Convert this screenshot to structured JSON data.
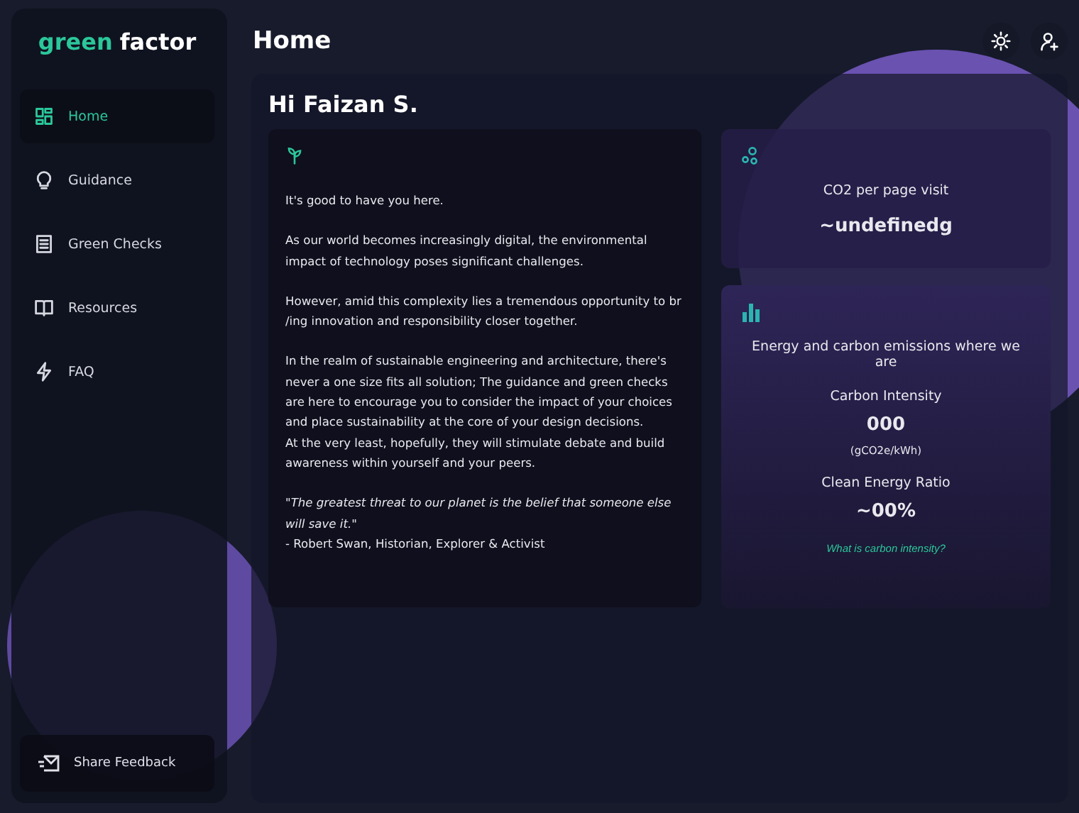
{
  "sidebar": {
    "logo": {
      "accent": "green",
      "rest": "factor"
    },
    "items": [
      {
        "label": "Home",
        "selected": true
      },
      {
        "label": "Guidance",
        "selected": false
      },
      {
        "label": "Green Checks",
        "selected": false
      },
      {
        "label": "Resources",
        "selected": false
      },
      {
        "label": "FAQ",
        "selected": false
      }
    ],
    "footer_button": "Share Feedback"
  },
  "header": {
    "title": "Home"
  },
  "greeting": {
    "hello": "Hi",
    "name": "Faizan S."
  },
  "intro": {
    "paragraphs": [
      {
        "text": "It's good to have you here.",
        "kind": "para"
      },
      {
        "text": "As our world becomes increasingly digital, the environmental impact of technology poses significant challenges.",
        "kind": "para"
      },
      {
        "text": "However, amid this complexity lies a tremendous opportunity to br /ing innovation and responsibility closer together.",
        "kind": "para"
      },
      {
        "text": "In the realm of sustainable engineering and architecture, there's never a one size fits all solution; The guidance and green checks are here to encourage you to consider the impact of your choices and place sustainability at the core of your design decisions.",
        "kind": "line"
      },
      {
        "text": "At the very least, hopefully, they will stimulate debate and build awareness within yourself and your peers.",
        "kind": "para"
      },
      {
        "text": "\"The greatest threat to our planet is the belief that someone else will save it.\"",
        "kind": "quote"
      },
      {
        "text": "- Robert Swan, Historian, Explorer & Activist",
        "kind": "line"
      }
    ]
  },
  "co2_card": {
    "label": "CO2 per page visit",
    "value": "~undefinedg"
  },
  "energy_card": {
    "title": "Energy and carbon emissions where we are",
    "intensity_label": "Carbon Intensity",
    "intensity_value": "000",
    "intensity_unit": "(gCO2e/kWh)",
    "ratio_label": "Clean Energy Ratio",
    "ratio_value": "~00%",
    "link": "What is carbon intensity?"
  }
}
